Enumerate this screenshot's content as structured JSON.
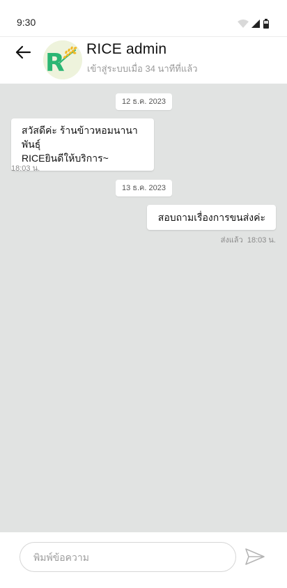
{
  "status_bar": {
    "time": "9:30",
    "icons": [
      "wifi-icon",
      "signal-icon",
      "battery-icon"
    ]
  },
  "header": {
    "back_icon": "arrow-left-icon",
    "avatar_letter": "R",
    "name": "RICE admin",
    "last_seen": "เข้าสู่ระบบเมื่อ 34 นาทีที่แล้ว"
  },
  "chat": {
    "messages": [
      {
        "date": "12 ธ.ค. 2023",
        "direction": "incoming",
        "lines": [
          "สวัสดีค่ะ ร้านข้าวหอมนานาพันธุ์",
          "RICEยินดีให้บริการ~"
        ],
        "time": "18:03 น."
      },
      {
        "date": "13 ธ.ค. 2023",
        "direction": "outgoing",
        "lines": [
          "สอบถามเรื่องการขนส่งค่ะ"
        ],
        "status": "ส่งแล้ว",
        "time": "18:03 น."
      }
    ]
  },
  "composer": {
    "placeholder": "พิมพ์ข้อความ",
    "value": "",
    "send_icon": "send-icon"
  },
  "colors": {
    "chat_background": "#e1e3e2",
    "logo_green": "#2bb673",
    "logo_yellow": "#f2b824",
    "avatar_background": "#eef3dc"
  }
}
